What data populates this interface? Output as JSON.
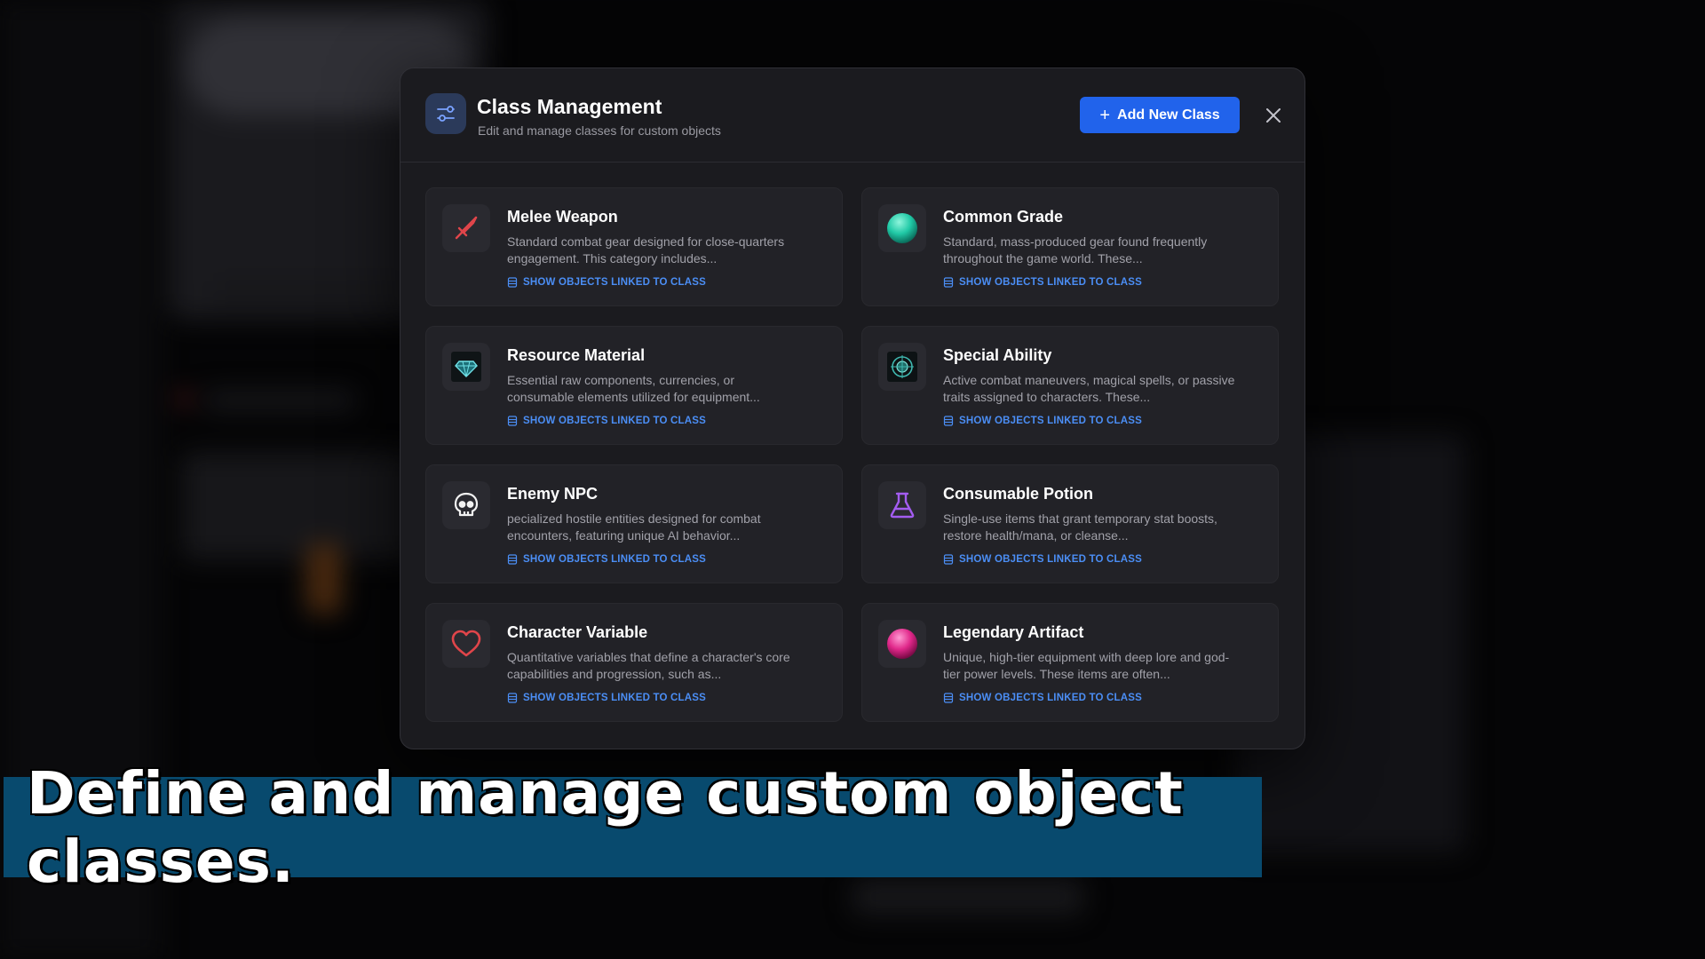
{
  "modal": {
    "title": "Class Management",
    "subtitle": "Edit and manage classes for custom objects",
    "header_icon": "sliders-icon",
    "add_button_label": "Add New Class",
    "close_icon": "close-icon"
  },
  "link_label": "SHOW OBJECTS LINKED TO CLASS",
  "classes": [
    {
      "title": "Melee Weapon",
      "description": "Standard combat gear designed for close-quarters engagement. This category includes...",
      "icon": "sword-icon",
      "icon_color": "#e0454a"
    },
    {
      "title": "Common Grade",
      "description": "Standard, mass-produced gear found frequently throughout the game world. These...",
      "icon": "teal-orb-icon",
      "icon_color": "#20c9a6"
    },
    {
      "title": "Resource Material",
      "description": "Essential raw components, currencies, or consumable elements utilized for equipment...",
      "icon": "gem-icon",
      "icon_color": "#3fc0c8"
    },
    {
      "title": "Special Ability",
      "description": "Active combat maneuvers, magical spells, or passive traits assigned to characters. These...",
      "icon": "rune-icon",
      "icon_color": "#3fb8b0"
    },
    {
      "title": "Enemy NPC",
      "description": "pecialized hostile entities designed for combat encounters, featuring unique AI behavior...",
      "icon": "skull-icon",
      "icon_color": "#f2f2f2"
    },
    {
      "title": "Consumable Potion",
      "description": "Single-use items that grant temporary stat boosts, restore health/mana, or cleanse...",
      "icon": "flask-icon",
      "icon_color": "#a35cf0"
    },
    {
      "title": "Character Variable",
      "description": "Quantitative variables that define a character's core capabilities and progression, such as...",
      "icon": "heart-icon",
      "icon_color": "#e0454a"
    },
    {
      "title": "Legendary Artifact",
      "description": "Unique, high-tier equipment with deep lore and god-tier power levels. These items are often...",
      "icon": "magenta-orb-icon",
      "icon_color": "#e0288a"
    }
  ],
  "caption": "Define and manage custom object classes.",
  "colors": {
    "accent": "#2163eb",
    "link": "#4b8ef5",
    "caption_bg": "#084a6e"
  }
}
